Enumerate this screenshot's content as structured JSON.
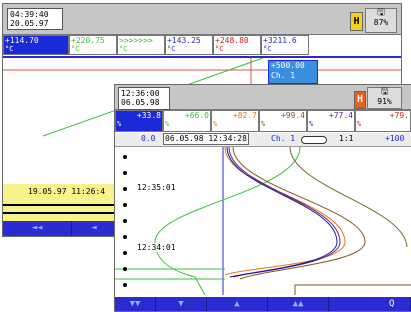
{
  "back_screen": {
    "clock_time": "04:39:40",
    "clock_date": "20.05.97",
    "hold_label": "H",
    "memory_icon": "floppy-icon",
    "memory_percent": "87%",
    "channels": [
      {
        "value": "+114.70",
        "unit": "°C",
        "color": "#ffffff"
      },
      {
        "value": "+220.75",
        "unit": "°C",
        "color": "#3bbf3b"
      },
      {
        "value": ">>>>>>>",
        "unit": "°C",
        "color": "#3bbf3b"
      },
      {
        "value": "+143.25",
        "unit": "°C",
        "color": "#2a2ad0"
      },
      {
        "value": "+248.80",
        "unit": "°C",
        "color": "#c02020"
      },
      {
        "value": "+3211.6",
        "unit": "°C",
        "color": "#2a2ad0"
      }
    ],
    "channel_popup_value": "+500.00",
    "channel_popup_label": "Ch. 1",
    "timestamp": "19.05.97 11:26:4",
    "nav_buttons": [
      "◄◄",
      "◄"
    ]
  },
  "front_screen": {
    "clock_time": "12:36:00",
    "clock_date": "06.05.98",
    "hold_label": "H",
    "memory_icon": "floppy-icon",
    "memory_percent": "91%",
    "channels": [
      {
        "value": "+33.8",
        "unit": "%",
        "color": "#ffffff"
      },
      {
        "value": "+66.0",
        "unit": "%",
        "color": "#3bbf3b"
      },
      {
        "value": "+82.7",
        "unit": "%",
        "color": "#e07a1a"
      },
      {
        "value": "+99.4",
        "unit": "%",
        "color": "#7a5a1a"
      },
      {
        "value": "+77.4",
        "unit": "%",
        "color": "#6a1a8a"
      },
      {
        "value": "+79.",
        "unit": "%",
        "color": "#c02020"
      }
    ],
    "scale_min": "0.0",
    "date_time": "06.05.98 12:34:28",
    "channel_label": "Ch. 1",
    "zoom": "1:1",
    "scale_max": "+100",
    "time_labels": [
      "12:35:01",
      "12:34:01"
    ],
    "nav_buttons": [
      "▼▼",
      "▼",
      "▲",
      "▲▲",
      "Q"
    ]
  }
}
